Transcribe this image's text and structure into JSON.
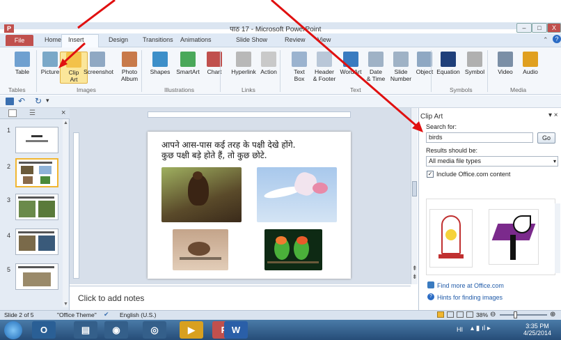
{
  "window": {
    "title": "पाठ 17 - Microsoft PowerPoint",
    "app_icon": "P",
    "controls": [
      "–",
      "□",
      "X"
    ]
  },
  "tabs": [
    {
      "label": "File"
    },
    {
      "label": "Home"
    },
    {
      "label": "Insert"
    },
    {
      "label": "Design"
    },
    {
      "label": "Transitions"
    },
    {
      "label": "Animations"
    },
    {
      "label": "Slide Show"
    },
    {
      "label": "Review"
    },
    {
      "label": "View"
    }
  ],
  "ribbon": {
    "buttons": [
      {
        "l1": "Table",
        "l2": "",
        "icon": "table-icon",
        "color": "#6fa0d0"
      },
      {
        "l1": "Picture",
        "l2": "",
        "icon": "picture-icon",
        "color": "#7aa8c8"
      },
      {
        "l1": "Clip",
        "l2": "Art",
        "icon": "clip-art-icon",
        "color": "#f3c24a"
      },
      {
        "l1": "Screenshot",
        "l2": "",
        "icon": "screenshot-icon",
        "color": "#8fa8c3"
      },
      {
        "l1": "Photo",
        "l2": "Album",
        "icon": "photo-album-icon",
        "color": "#c87a4a"
      },
      {
        "l1": "Shapes",
        "l2": "",
        "icon": "shapes-icon",
        "color": "#3d8fc9"
      },
      {
        "l1": "SmartArt",
        "l2": "",
        "icon": "smartart-icon",
        "color": "#4aa85a"
      },
      {
        "l1": "Chart",
        "l2": "",
        "icon": "chart-icon",
        "color": "#c0504d"
      },
      {
        "l1": "Hyperlink",
        "l2": "",
        "icon": "hyperlink-icon",
        "color": "#b8b8b8"
      },
      {
        "l1": "Action",
        "l2": "",
        "icon": "action-icon",
        "color": "#c9c9c9"
      },
      {
        "l1": "Text",
        "l2": "Box",
        "icon": "text-box-icon",
        "color": "#9bb3cf"
      },
      {
        "l1": "Header",
        "l2": "& Footer",
        "icon": "header-footer-icon",
        "color": "#b9c7d8"
      },
      {
        "l1": "WordArt",
        "l2": "",
        "icon": "wordart-icon",
        "color": "#3a7bc0"
      },
      {
        "l1": "Date",
        "l2": "& Time",
        "icon": "date-time-icon",
        "color": "#9fb2c6"
      },
      {
        "l1": "Slide",
        "l2": "Number",
        "icon": "slide-number-icon",
        "color": "#9fb2c6"
      },
      {
        "l1": "Object",
        "l2": "",
        "icon": "object-icon",
        "color": "#8fa8c3"
      },
      {
        "l1": "Equation",
        "l2": "",
        "icon": "equation-icon",
        "color": "#1f3f7a"
      },
      {
        "l1": "Symbol",
        "l2": "",
        "icon": "symbol-icon",
        "color": "#b0b0b0"
      },
      {
        "l1": "Video",
        "l2": "",
        "icon": "video-icon",
        "color": "#7b8fa6"
      },
      {
        "l1": "Audio",
        "l2": "",
        "icon": "audio-icon",
        "color": "#e0a020"
      }
    ],
    "groups": [
      "Tables",
      "Images",
      "Illustrations",
      "Links",
      "Text",
      "Symbols",
      "Media"
    ]
  },
  "slides": {
    "items": [
      {
        "num": "1"
      },
      {
        "num": "2"
      },
      {
        "num": "3"
      },
      {
        "num": "4"
      },
      {
        "num": "5"
      }
    ],
    "selected": "2"
  },
  "slide_content": {
    "line1": "आपने आस-पास कई तरह के पक्षी देखे होंगे.",
    "line2": "कुछ पक्षी बड़े होते हैं, तो कुछ छोटे."
  },
  "notes": {
    "placeholder": "Click to add notes"
  },
  "clip_art": {
    "title": "Clip Art",
    "search_label": "Search for:",
    "search_value": "birds",
    "go_label": "Go",
    "results_label": "Results should be:",
    "results_value": "All media file types",
    "include_label": "Include Office.com content",
    "find_more": "Find more at Office.com",
    "hints": "Hints for finding images"
  },
  "status": {
    "slide": "Slide 2 of 5",
    "theme": "\"Office Theme\"",
    "language": "English (U.S.)",
    "zoom": "38%"
  },
  "taskbar": {
    "time": "3:35 PM",
    "date": "4/25/2014",
    "lang": "HI"
  },
  "colors": {
    "accent": "#c0504d",
    "arrow": "#e01010",
    "selected": "#f1b631"
  }
}
